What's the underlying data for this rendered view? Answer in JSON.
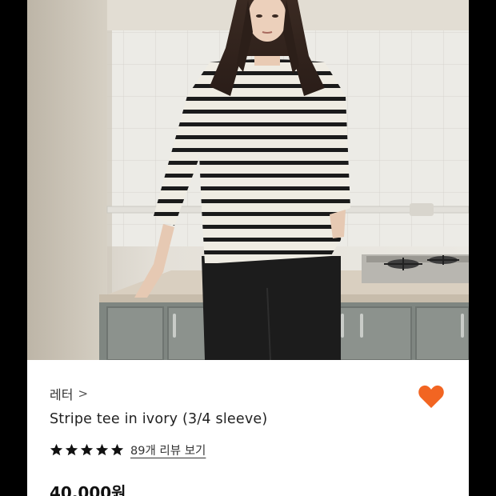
{
  "product": {
    "brand": "레터",
    "brand_chevron": ">",
    "title": "Stripe tee in ivory (3/4 sleeve)",
    "rating_stars": 5,
    "reviews_link": "89개 리뷰 보기",
    "price": "40,000원",
    "wishlist_icon": "heart-icon",
    "accent_color": "#f26522"
  }
}
